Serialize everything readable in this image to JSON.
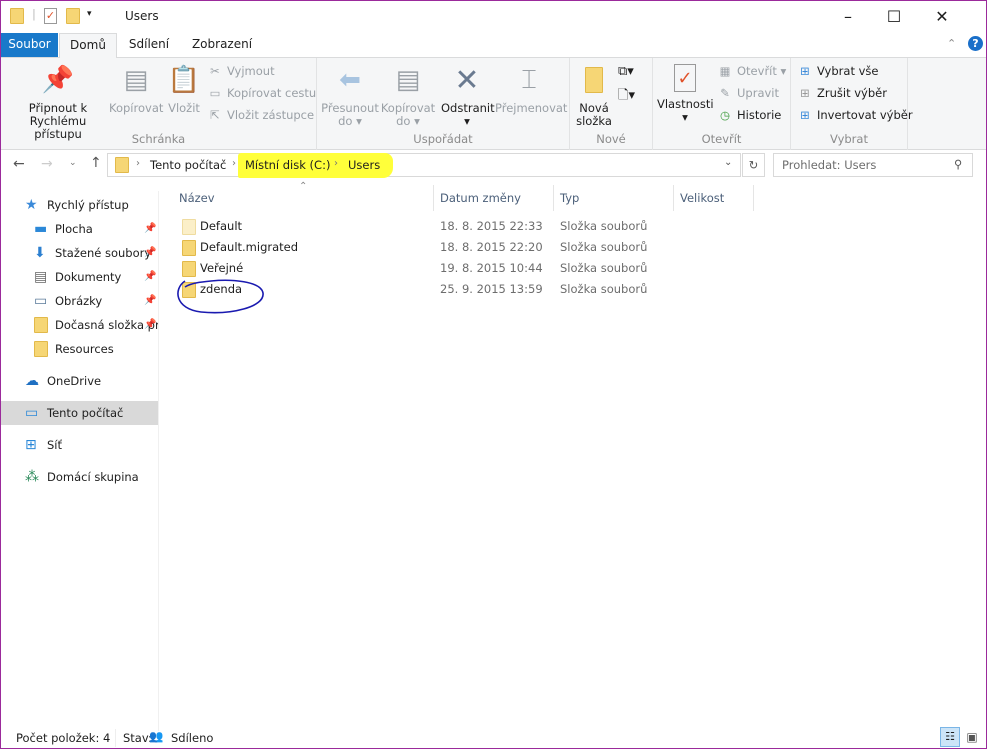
{
  "window": {
    "title": "Users",
    "minimize": "–",
    "maximize": "☐",
    "close": "✕",
    "border_color": "#9b2a9b"
  },
  "tabs": {
    "file": "Soubor",
    "home": "Domů",
    "share": "Sdílení",
    "view": "Zobrazení",
    "active": "Domů"
  },
  "ribbon": {
    "clipboard": {
      "label": "Schránka",
      "pin": "Připnout k Rychlému přístupu",
      "copy": "Kopírovat",
      "paste": "Vložit",
      "cut": "Vyjmout",
      "copy_path": "Kopírovat cestu",
      "paste_shortcut": "Vložit zástupce"
    },
    "organize": {
      "label": "Uspořádat",
      "move_to": "Přesunout do",
      "copy_to": "Kopírovat do",
      "delete": "Odstranit",
      "rename": "Přejmenovat"
    },
    "new": {
      "label": "Nové",
      "new_folder": "Nová složka"
    },
    "open": {
      "label": "Otevřít",
      "properties": "Vlastnosti",
      "open": "Otevřít",
      "edit": "Upravit",
      "history": "Historie"
    },
    "select": {
      "label": "Vybrat",
      "select_all": "Vybrat vše",
      "select_none": "Zrušit výběr",
      "invert": "Invertovat výběr"
    }
  },
  "address": {
    "crumbs": [
      "Tento počítač",
      "Místní disk (C:)",
      "Users"
    ],
    "highlight_color": "#ffff3a"
  },
  "search": {
    "placeholder": "Prohledat: Users"
  },
  "nav": {
    "items": [
      {
        "label": "Rychlý přístup",
        "icon": "star-icon"
      },
      {
        "label": "Plocha",
        "icon": "desktop-icon",
        "pinned": true
      },
      {
        "label": "Stažené soubory",
        "icon": "download-icon",
        "pinned": true
      },
      {
        "label": "Dokumenty",
        "icon": "document-icon",
        "pinned": true
      },
      {
        "label": "Obrázky",
        "icon": "pictures-icon",
        "pinned": true
      },
      {
        "label": "Dočasná složka pro",
        "icon": "folder-icon",
        "pinned": true
      },
      {
        "label": "Resources",
        "icon": "folder-icon"
      },
      {
        "label": "OneDrive",
        "icon": "cloud-icon"
      },
      {
        "label": "Tento počítač",
        "icon": "computer-icon",
        "selected": true
      },
      {
        "label": "Síť",
        "icon": "network-icon"
      },
      {
        "label": "Domácí skupina",
        "icon": "homegroup-icon"
      }
    ]
  },
  "columns": {
    "name": "Název",
    "date": "Datum změny",
    "type": "Typ",
    "size": "Velikost"
  },
  "files": [
    {
      "name": "Default",
      "date": "18. 8. 2015 22:33",
      "type": "Složka souborů"
    },
    {
      "name": "Default.migrated",
      "date": "18. 8. 2015 22:20",
      "type": "Složka souborů"
    },
    {
      "name": "Veřejné",
      "date": "19. 8. 2015 10:44",
      "type": "Složka souborů"
    },
    {
      "name": "zdenda",
      "date": "25. 9. 2015 13:59",
      "type": "Složka souborů",
      "circled": true
    }
  ],
  "status": {
    "count": "Počet položek: 4",
    "state_label": "Stav:",
    "state": "Sdíleno"
  }
}
